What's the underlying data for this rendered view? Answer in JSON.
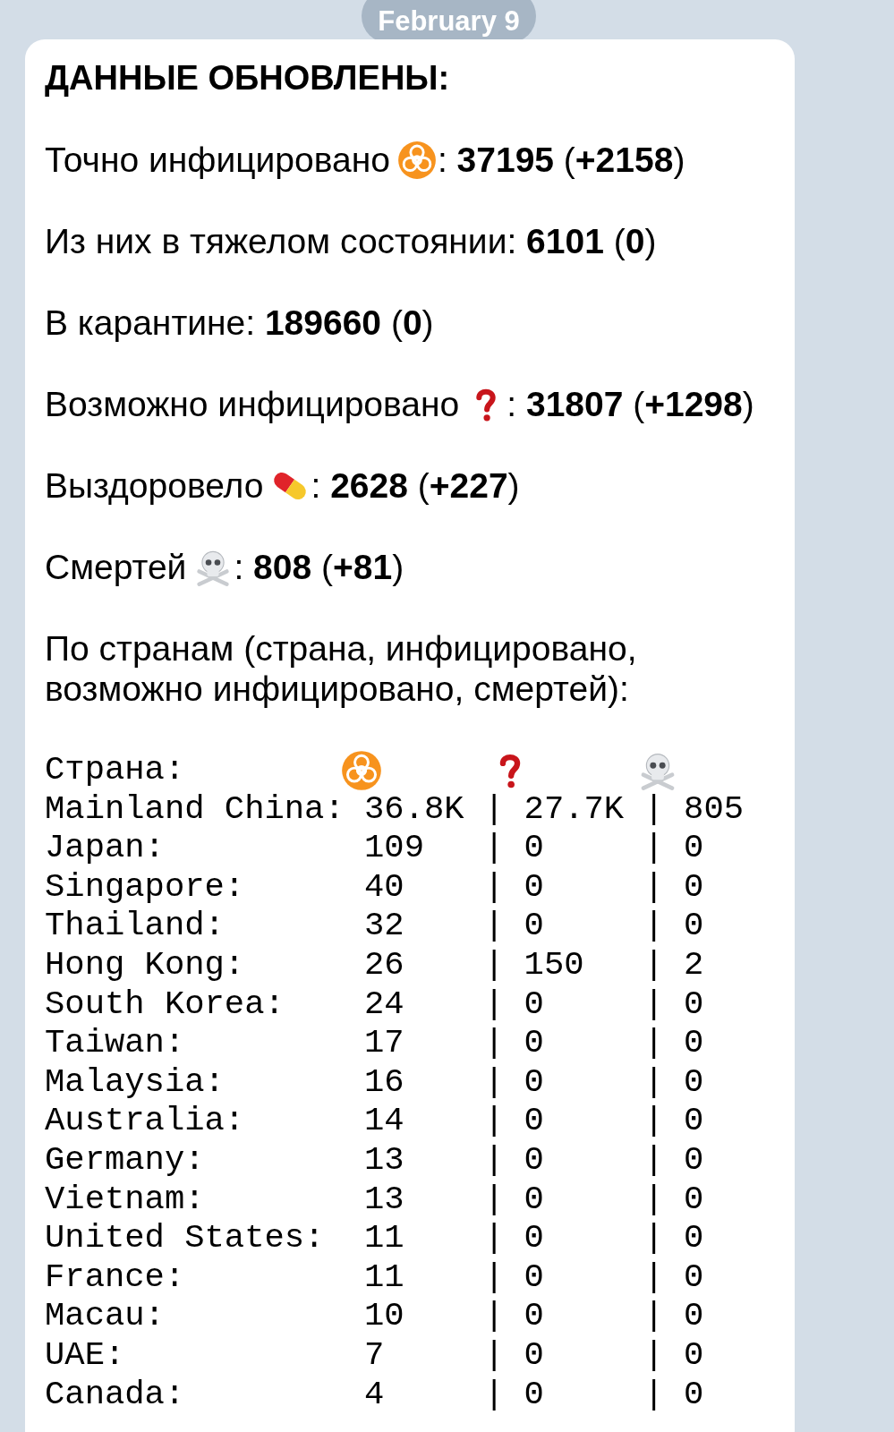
{
  "date_badge": "February 9",
  "message": {
    "heading": "ДАННЫЕ ОБНОВЛЕНЫ:",
    "stats": [
      {
        "kind": "infected",
        "before": "Точно инфицировано",
        "after": ": **37195** (**+2158**)"
      },
      {
        "kind": "plain",
        "text": "Из них в тяжелом состоянии: **6101** (**0**)"
      },
      {
        "kind": "plain",
        "text": "В карантине: **189660** (**0**)"
      },
      {
        "kind": "suspected",
        "before": "Возможно инфицировано",
        "after": ": **31807** (**+1298**)"
      },
      {
        "kind": "recovered",
        "before": "Выздоровело",
        "after": ": **2628** (**+227**)"
      },
      {
        "kind": "deaths",
        "before": "Смертей",
        "after": ": **808** (**+81**)"
      }
    ],
    "countries_intro": "По странам (страна, инфицировано, возможно инфицировано, смертей):",
    "table": {
      "header_label": "Страна:",
      "rows": [
        "Mainland China: 36.8K | 27.7K | 805",
        "Japan:          109   | 0     | 0",
        "Singapore:      40    | 0     | 0",
        "Thailand:       32    | 0     | 0",
        "Hong Kong:      26    | 150   | 2",
        "South Korea:    24    | 0     | 0",
        "Taiwan:         17    | 0     | 0",
        "Malaysia:       16    | 0     | 0",
        "Australia:      14    | 0     | 0",
        "Germany:        13    | 0     | 0",
        "Vietnam:        13    | 0     | 0",
        "United States:  11    | 0     | 0",
        "France:         11    | 0     | 0",
        "Macau:          10    | 0     | 0",
        "UAE:            7     | 0     | 0",
        "Canada:         4     | 0     | 0"
      ]
    }
  }
}
